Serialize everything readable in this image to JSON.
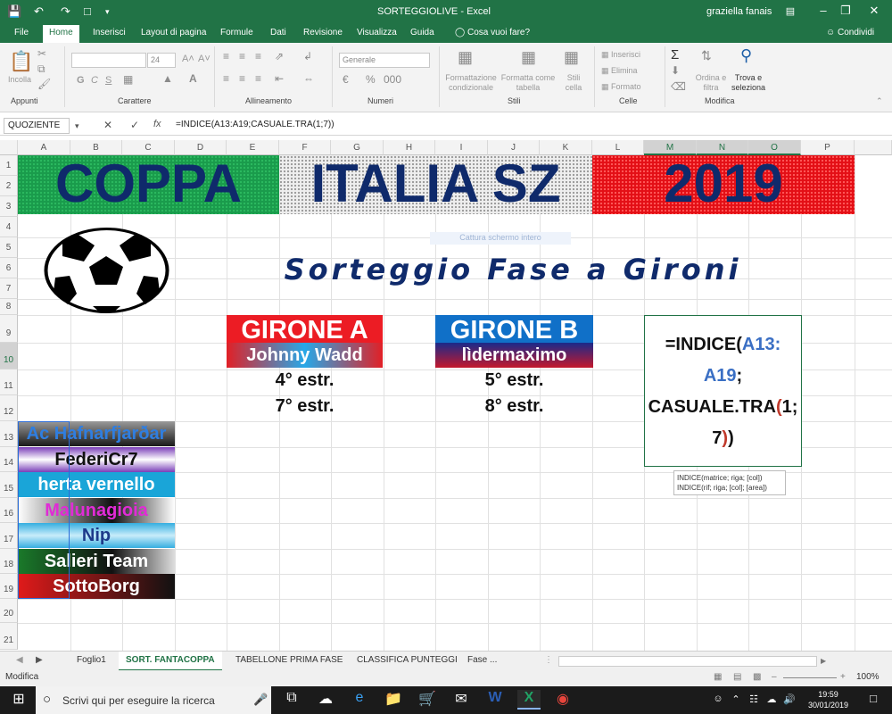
{
  "app": {
    "doc_title": "SORTEGGIOLIVE",
    "app_name": "Excel",
    "separator": "-",
    "user": "graziella fanais"
  },
  "menu": [
    "File",
    "Home",
    "Inserisci",
    "Layout di pagina",
    "Formule",
    "Dati",
    "Revisione",
    "Visualizza",
    "Guida"
  ],
  "tell_me": "Cosa vuoi fare?",
  "share": "Condividi",
  "ribbon": {
    "clipboard": {
      "paste": "Incolla",
      "label": "Appunti"
    },
    "font": {
      "size": "24",
      "bold": "G",
      "italic": "C",
      "underline": "S",
      "label": "Carattere"
    },
    "alignment": {
      "label": "Allineamento"
    },
    "number": {
      "format": "Generale",
      "label": "Numeri"
    },
    "styles": {
      "cond": "Formattazione condizionale",
      "table": "Formatta come tabella",
      "cell": "Stili cella",
      "label": "Stili"
    },
    "cells": {
      "insert": "Inserisci",
      "delete": "Elimina",
      "format": "Formato",
      "label": "Celle"
    },
    "editing": {
      "sort": "Ordina e filtra",
      "find": "Trova e seleziona",
      "label": "Modifica"
    }
  },
  "formula_bar": {
    "name_box": "QUOZIENTE",
    "cancel": "✕",
    "enter": "✓",
    "fx": "fx",
    "formula": "=INDICE(A13:A19;CASUALE.TRA(1;7))"
  },
  "columns": [
    "A",
    "B",
    "C",
    "D",
    "E",
    "F",
    "G",
    "H",
    "I",
    "J",
    "K",
    "L",
    "M",
    "N",
    "O",
    "P"
  ],
  "rows": [
    "1",
    "2",
    "3",
    "4",
    "5",
    "6",
    "7",
    "8",
    "9",
    "10",
    "11",
    "12",
    "13",
    "14",
    "15",
    "16",
    "17",
    "18",
    "19",
    "20",
    "21"
  ],
  "banner": {
    "left": "COPPA",
    "middle": "ITALIA SZ",
    "right": "2019"
  },
  "subtitle": "Sorteggio Fase a Gironi",
  "watermark": "Cattura schermo intero",
  "groups": [
    {
      "title": "GIRONE A",
      "manager": "Johnny Wadd",
      "picks": [
        "4° estr.",
        "7° estr."
      ]
    },
    {
      "title": "GIRONE B",
      "manager": "lìdermaximo",
      "picks": [
        "5° estr.",
        "8° estr."
      ]
    }
  ],
  "teams": [
    "Ac Hafnarfjarðar",
    "FederiCr7",
    "herta vernello",
    "Malunagioia",
    "Nip",
    "Salieri Team",
    "SottoBorg"
  ],
  "edit_cell": {
    "l1a": "=INDICE(",
    "l1b": "A13:",
    "l2a": "A19",
    "l2b": ";",
    "l3a": "CASUALE.TRA",
    "l3b": "(",
    "l3c": "1;",
    "l4a": "7",
    "l4b": ")",
    "l4c": ")"
  },
  "tooltip": {
    "line1": "INDICE(matrice; riga; [col])",
    "line2": "INDICE(rif; riga; [col]; [area])"
  },
  "sheet_tabs": [
    "Foglio1",
    "SORT. FANTACOPPA",
    "TABELLONE PRIMA FASE",
    "CLASSIFICA PUNTEGGI",
    "Fase ..."
  ],
  "status": {
    "mode": "Modifica",
    "zoom": "100%"
  },
  "taskbar": {
    "search": "Scrivi qui per eseguire la ricerca",
    "time": "19:59",
    "date": "30/01/2019"
  },
  "colors": {
    "excel_green": "#217346",
    "banner_green": "#1a9b4c",
    "banner_red": "#e30f16",
    "banner_text": "#0f2a6b",
    "girone_red": "#ec1c24",
    "girone_blue": "#1070c8"
  }
}
